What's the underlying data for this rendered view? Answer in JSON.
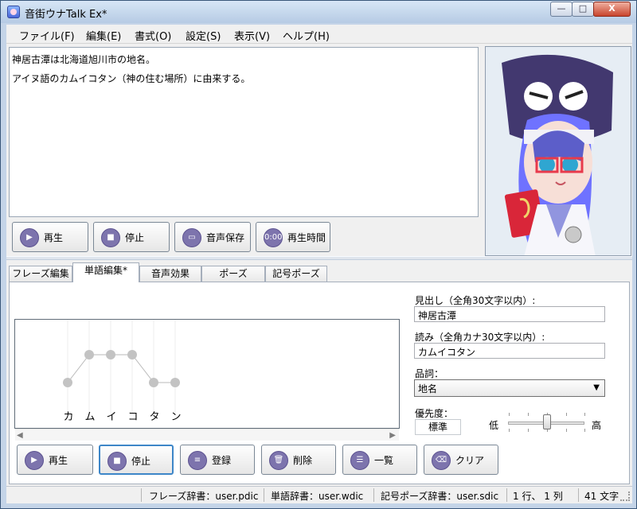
{
  "window": {
    "title": "音街ウナTalk Ex*",
    "close_symbol": "X"
  },
  "menu": [
    "ファイル(F)",
    "編集(E)",
    "書式(O)",
    "設定(S)",
    "表示(V)",
    "ヘルプ(H)"
  ],
  "editor": {
    "lines": [
      "神居古潭は北海道旭川市の地名。",
      "アイヌ語のカムイコタン（神の住む場所）に由来する。"
    ]
  },
  "top_buttons": [
    {
      "label": "再生",
      "icon": "play-icon"
    },
    {
      "label": "停止",
      "icon": "stop-icon"
    },
    {
      "label": "音声保存",
      "icon": "save-icon"
    },
    {
      "label": "再生時間",
      "icon": "time-icon",
      "icon_text": "0:00"
    }
  ],
  "tabs": [
    "フレーズ編集",
    "単語編集*",
    "音声効果",
    "ポーズ",
    "記号ポーズ"
  ],
  "pitch": {
    "kana": [
      "カ",
      "ム",
      "イ",
      "コ",
      "タ",
      "ン"
    ],
    "levels": [
      0,
      1,
      1,
      1,
      0,
      0
    ]
  },
  "word_editor": {
    "heading_label": "見出し（全角30文字以内）:",
    "heading_value": "神居古潭",
    "reading_label": "読み（全角カナ30文字以内）:",
    "reading_value": "カムイコタン",
    "pos_label": "品詞：",
    "pos_value": "地名",
    "priority_label": "優先度：",
    "priority_value": "標準",
    "low_label": "低",
    "high_label": "高",
    "priority_level_fraction": 0.5
  },
  "bottom_buttons": [
    {
      "label": "再生",
      "icon": "play-icon"
    },
    {
      "label": "停止",
      "icon": "stop-icon"
    },
    {
      "label": "登録",
      "icon": "register-icon"
    },
    {
      "label": "削除",
      "icon": "trash-icon"
    },
    {
      "label": "一覧",
      "icon": "list-icon"
    },
    {
      "label": "クリア",
      "icon": "eraser-icon"
    }
  ],
  "status": {
    "phrase_dict": "フレーズ辞書：user.pdic",
    "word_dict": "単語辞書：user.wdic",
    "symbol_dict": "記号ポーズ辞書：user.sdic",
    "position": "1 行、 1 列",
    "chars": "41 文字"
  },
  "colors": {
    "button_icon": "#7d74ad",
    "focus": "#3d86c8",
    "pitch_line": "#b8b8b8",
    "pitch_dot": "#c3c3c3"
  }
}
